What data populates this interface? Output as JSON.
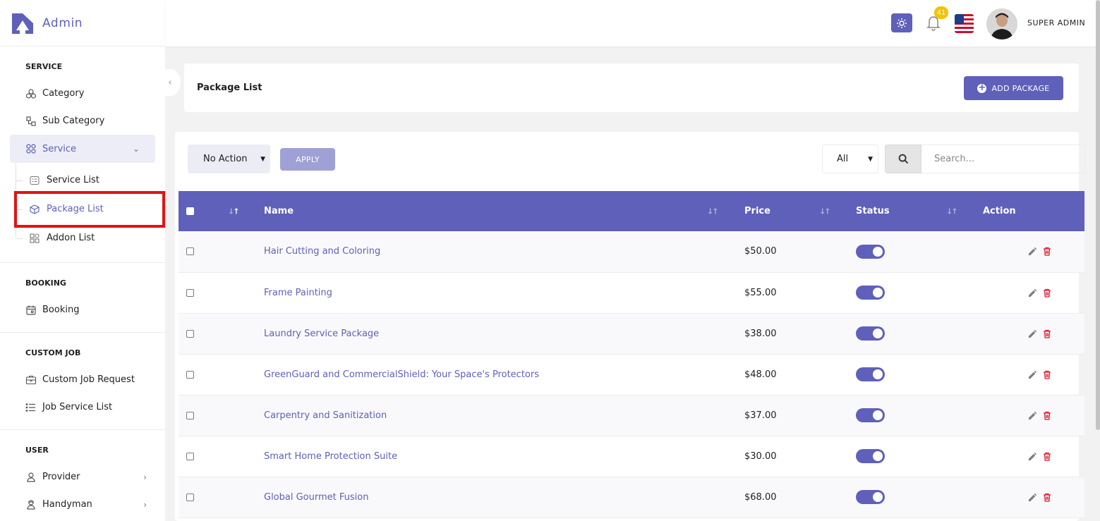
{
  "brand": {
    "title": "Admin"
  },
  "sidebar": {
    "sections": [
      {
        "title": "SERVICE"
      },
      {
        "title": "BOOKING"
      },
      {
        "title": "CUSTOM JOB"
      },
      {
        "title": "USER"
      }
    ],
    "items": {
      "category": "Category",
      "sub_category": "Sub Category",
      "service": "Service",
      "service_list": "Service List",
      "package_list": "Package List",
      "addon_list": "Addon List",
      "booking": "Booking",
      "custom_job_request": "Custom Job Request",
      "job_service_list": "Job Service List",
      "provider": "Provider",
      "handyman": "Handyman"
    }
  },
  "topbar": {
    "notification_count": "41",
    "user_name": "SUPER ADMIN"
  },
  "page": {
    "title": "Package List",
    "add_button": "ADD PACKAGE"
  },
  "controls": {
    "bulk_action": "No Action",
    "apply": "APPLY",
    "filter": "All",
    "search_placeholder": "Search..."
  },
  "table": {
    "headers": {
      "name": "Name",
      "price": "Price",
      "status": "Status",
      "action": "Action"
    },
    "rows": [
      {
        "name": "Hair Cutting and Coloring",
        "price": "$50.00"
      },
      {
        "name": "Frame Painting",
        "price": "$55.00"
      },
      {
        "name": "Laundry Service Package",
        "price": "$38.00"
      },
      {
        "name": "GreenGuard and CommercialShield: Your Space's Protectors",
        "price": "$48.00"
      },
      {
        "name": "Carpentry and Sanitization",
        "price": "$37.00"
      },
      {
        "name": "Smart Home Protection Suite",
        "price": "$30.00"
      },
      {
        "name": "Global Gourmet Fusion",
        "price": "$68.00"
      }
    ]
  },
  "colors": {
    "accent": "#5f60b9",
    "danger": "#e3132c",
    "badge": "#f2c300"
  }
}
